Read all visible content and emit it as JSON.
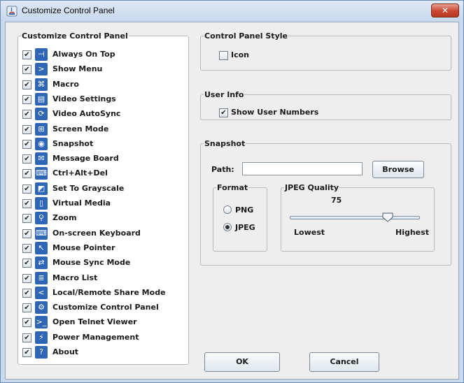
{
  "window": {
    "title": "Customize Control Panel",
    "close_glyph": "✕"
  },
  "features_group": {
    "legend": "Customize Control Panel",
    "items": [
      {
        "label": "Always On Top",
        "checked": true,
        "icon": "pin-icon",
        "glyph": "⊣"
      },
      {
        "label": "Show Menu",
        "checked": true,
        "icon": "chevron-right-icon",
        "glyph": ">"
      },
      {
        "label": "Macro",
        "checked": true,
        "icon": "macro-icon",
        "glyph": "⌘"
      },
      {
        "label": "Video Settings",
        "checked": true,
        "icon": "video-settings-icon",
        "glyph": "▤"
      },
      {
        "label": "Video AutoSync",
        "checked": true,
        "icon": "autosync-icon",
        "glyph": "⟳"
      },
      {
        "label": "Screen Mode",
        "checked": true,
        "icon": "screen-mode-icon",
        "glyph": "⊞"
      },
      {
        "label": "Snapshot",
        "checked": true,
        "icon": "camera-icon",
        "glyph": "◉"
      },
      {
        "label": "Message Board",
        "checked": true,
        "icon": "message-board-icon",
        "glyph": "✉"
      },
      {
        "label": "Ctrl+Alt+Del",
        "checked": true,
        "icon": "keyboard-keys-icon",
        "glyph": "⌨"
      },
      {
        "label": "Set To Grayscale",
        "checked": true,
        "icon": "grayscale-icon",
        "glyph": "◩"
      },
      {
        "label": "Virtual Media",
        "checked": true,
        "icon": "usb-drive-icon",
        "glyph": "▯"
      },
      {
        "label": "Zoom",
        "checked": true,
        "icon": "magnifier-icon",
        "glyph": "⚲"
      },
      {
        "label": "On-screen Keyboard",
        "checked": true,
        "icon": "keyboard-icon",
        "glyph": "⌨"
      },
      {
        "label": "Mouse Pointer",
        "checked": true,
        "icon": "mouse-pointer-icon",
        "glyph": "↖"
      },
      {
        "label": "Mouse Sync Mode",
        "checked": true,
        "icon": "mouse-sync-icon",
        "glyph": "⇄"
      },
      {
        "label": "Macro List",
        "checked": true,
        "icon": "macro-list-icon",
        "glyph": "≣"
      },
      {
        "label": "Local/Remote Share Mode",
        "checked": true,
        "icon": "share-icon",
        "glyph": "<"
      },
      {
        "label": "Customize Control Panel",
        "checked": true,
        "icon": "customize-icon",
        "glyph": "⚙"
      },
      {
        "label": "Open Telnet Viewer",
        "checked": true,
        "icon": "terminal-icon",
        "glyph": ">_"
      },
      {
        "label": "Power Management",
        "checked": true,
        "icon": "power-icon",
        "glyph": "⚡"
      },
      {
        "label": "About",
        "checked": true,
        "icon": "help-icon",
        "glyph": "?"
      }
    ]
  },
  "style_group": {
    "legend": "Control Panel Style",
    "icon_label": "Icon",
    "icon_checked": false
  },
  "user_info_group": {
    "legend": "User Info",
    "show_numbers_label": "Show User Numbers",
    "show_numbers_checked": true
  },
  "snapshot_group": {
    "legend": "Snapshot",
    "path_label": "Path:",
    "path_value": "",
    "browse_label": "Browse",
    "format": {
      "legend": "Format",
      "options": [
        "PNG",
        "JPEG"
      ],
      "selected": "JPEG"
    },
    "jpeg_quality": {
      "legend": "JPEG Quality",
      "value": "75",
      "min_label": "Lowest",
      "max_label": "Highest",
      "level_percent": 75
    }
  },
  "buttons": {
    "ok": "OK",
    "cancel": "Cancel"
  },
  "colors": {
    "icon_blue": "#2f65b5",
    "close_red": "#c9452f",
    "window_frame": "#c9daee"
  }
}
